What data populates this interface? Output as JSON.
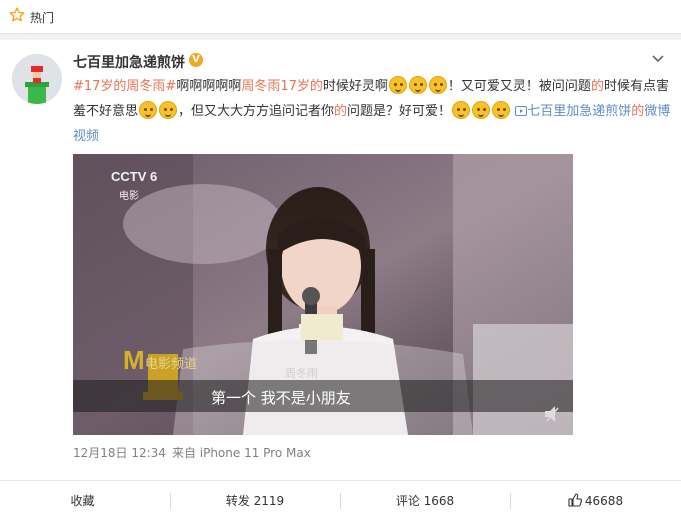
{
  "topbar": {
    "label": "热门",
    "icon": "star-icon"
  },
  "post": {
    "username": "七百里加急递煎饼",
    "verified_badge": "V",
    "content": {
      "tag": "#17岁的周冬雨#",
      "s1": "啊啊啊啊啊",
      "s2": "周冬雨17岁",
      "s3": "的",
      "s4": "时候好灵啊",
      "s5": "！又可爱又灵！被问问题",
      "s6": "的",
      "s7": "时候有点害羞不好意思",
      "s8": "，但又大大方方追问记者你",
      "s9": "的",
      "s10": "问题是？好可爱！",
      "video_link": "七百里加急递煎饼",
      "s11": "的",
      "video_link2": "微博视频"
    },
    "video": {
      "channel_logo": "CCTV 6",
      "channel_sub": "电影",
      "show_logo": "M",
      "show_logo_sub": "电影频道",
      "name_caption": "周冬雨",
      "subtitle": "第一个 我不是小朋友"
    },
    "time": "12月18日 12:34",
    "source": "来自 iPhone 11 Pro Max"
  },
  "actions": {
    "favorite": "收藏",
    "forward": "转发 2119",
    "comment": "评论 1668",
    "like": "46688"
  },
  "colors": {
    "accent": "#eb7350",
    "link": "#5d8cc7"
  }
}
